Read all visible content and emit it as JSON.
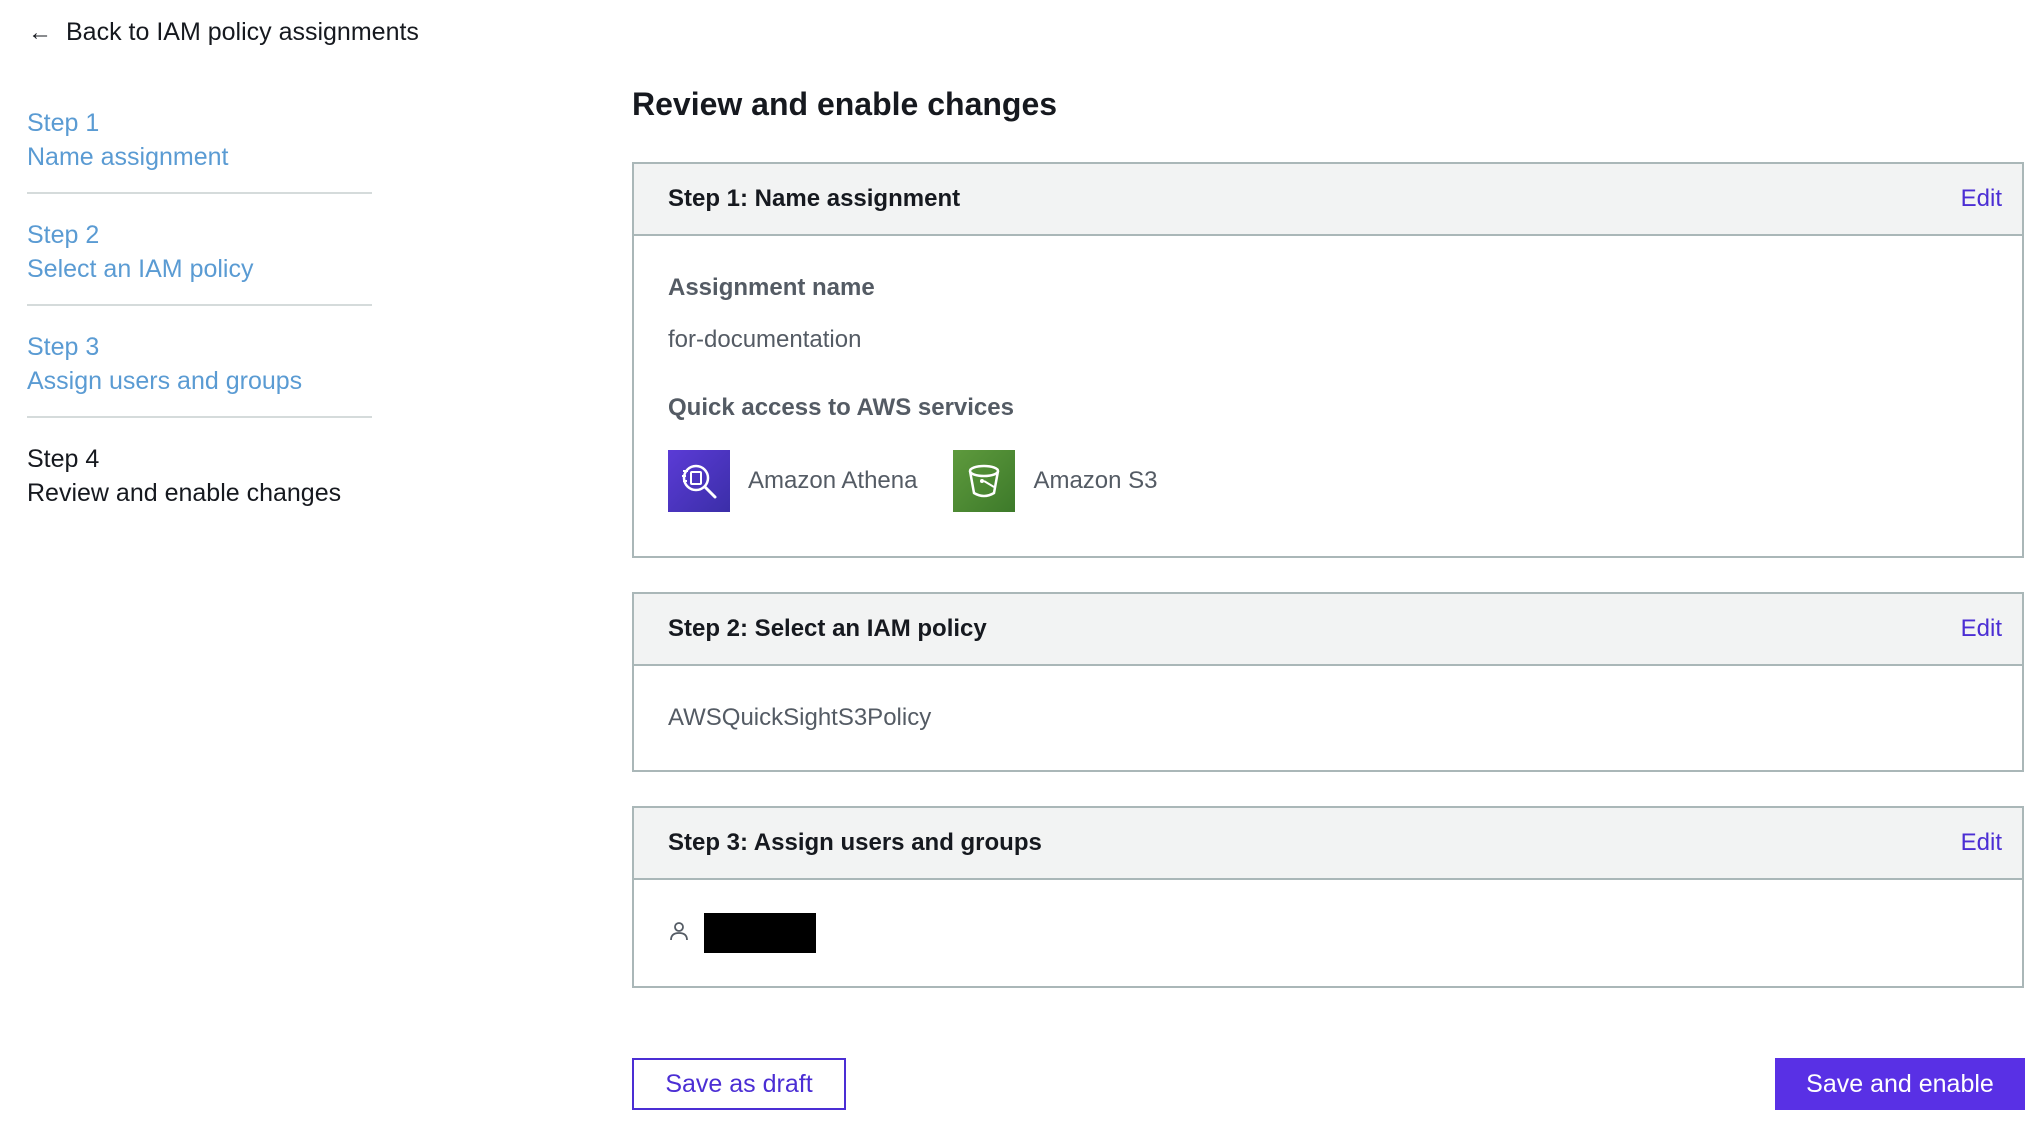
{
  "back_link": {
    "label": "Back to IAM policy assignments"
  },
  "steps": [
    {
      "num": "Step 1",
      "title": "Name assignment"
    },
    {
      "num": "Step 2",
      "title": "Select an IAM policy"
    },
    {
      "num": "Step 3",
      "title": "Assign users and groups"
    },
    {
      "num": "Step 4",
      "title": "Review and enable changes"
    }
  ],
  "main": {
    "heading": "Review and enable changes",
    "panel1": {
      "title": "Step 1: Name assignment",
      "edit": "Edit",
      "assignment_label": "Assignment name",
      "assignment_value": "for-documentation",
      "quick_access_label": "Quick access to AWS services",
      "services": [
        {
          "name": "Amazon Athena",
          "icon": "athena-icon"
        },
        {
          "name": "Amazon S3",
          "icon": "s3-bucket-icon"
        }
      ]
    },
    "panel2": {
      "title": "Step 2: Select an IAM policy",
      "edit": "Edit",
      "policy": "AWSQuickSightS3Policy"
    },
    "panel3": {
      "title": "Step 3: Assign users and groups",
      "edit": "Edit"
    }
  },
  "buttons": {
    "draft": "Save as draft",
    "enable": "Save and enable"
  },
  "colors": {
    "accent": "#4b2ed4",
    "primary_button": "#5930e5",
    "nav_link": "#5a9bd3",
    "athena": "#5b3bd6",
    "s3": "#5e9a3d"
  }
}
